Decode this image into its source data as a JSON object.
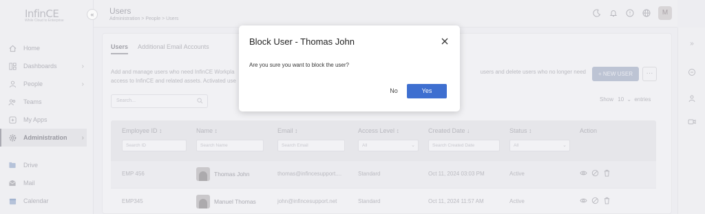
{
  "brand": {
    "name": "InfinCE",
    "tagline": "While Cloud to Enterprise"
  },
  "sidebar": {
    "items": [
      {
        "label": "Home",
        "icon": "home-icon"
      },
      {
        "label": "Dashboards",
        "icon": "dashboard-icon"
      },
      {
        "label": "People",
        "icon": "person-icon"
      },
      {
        "label": "Teams",
        "icon": "teams-icon"
      },
      {
        "label": "My Apps",
        "icon": "apps-icon"
      },
      {
        "label": "Administration",
        "icon": "gear-icon"
      },
      {
        "label": "Drive",
        "icon": "drive-icon"
      },
      {
        "label": "Mail",
        "icon": "mail-icon"
      },
      {
        "label": "Calendar",
        "icon": "calendar-icon"
      }
    ]
  },
  "header": {
    "title": "Users",
    "breadcrumb": "Administration  >  People  >  Users",
    "avatar_initial": "M"
  },
  "main": {
    "tabs": [
      {
        "label": "Users"
      },
      {
        "label": "Additional Email Accounts"
      }
    ],
    "description_line1": "Add and manage users who need InfinCE Workpla",
    "description_line1b": "users and delete users who no longer need",
    "description_line2": "access to InfinCE and related assets. Activated use",
    "new_user_label": "+ NEW USER",
    "more_label": "···",
    "search_placeholder": "Search...",
    "show_label": "Show",
    "show_value": "10",
    "entries_label": "entries"
  },
  "table": {
    "headers": {
      "employee_id": "Employee ID ↕",
      "name": "Name ↕",
      "email": "Email ↕",
      "access_level": "Access Level ↕",
      "created_date": "Created Date ↓",
      "status": "Status ↕",
      "action": "Action"
    },
    "filters": {
      "employee_id": "Search ID",
      "name": "Search Name",
      "email": "Search Email",
      "access_level": "All",
      "created_date": "Search Created Date",
      "status": "All"
    },
    "rows": [
      {
        "id": "EMP 456",
        "name": "Thomas John",
        "email": "thomas@infincesupport....",
        "access": "Standard",
        "created": "Oct 11, 2024 03:03 PM",
        "status": "Active"
      },
      {
        "id": "EMP345",
        "name": "Manuel Thomas",
        "email": "john@infincesupport.net",
        "access": "Standard",
        "created": "Oct 11, 2024 11:57 AM",
        "status": "Active"
      }
    ]
  },
  "modal": {
    "title": "Block User - Thomas John",
    "body": "Are you sure you want to block the user?",
    "no_label": "No",
    "yes_label": "Yes"
  },
  "colors": {
    "primary": "#3e6fd0",
    "modal_bg": "#ffffff"
  }
}
